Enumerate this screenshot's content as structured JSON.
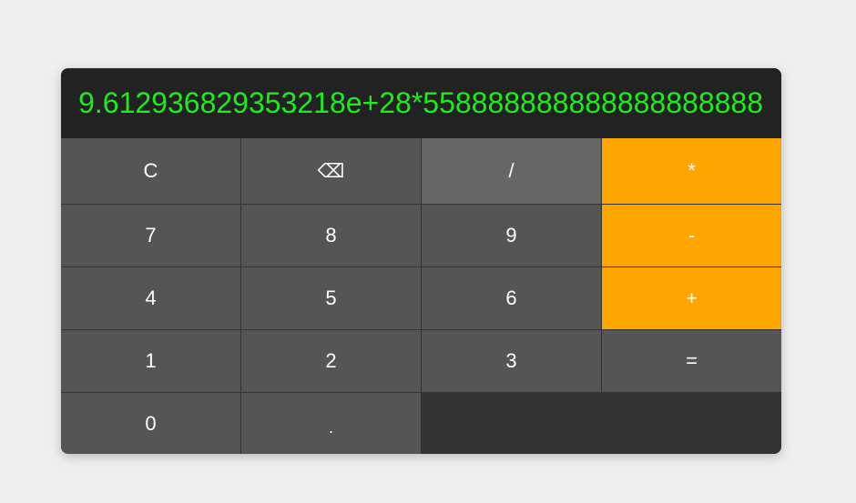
{
  "display": {
    "value": "9.612936829353218e+28*558888888888888888888"
  },
  "keys": {
    "row1": [
      "C",
      "⌫",
      "/",
      "*"
    ],
    "row2": [
      "7",
      "8",
      "9",
      "-"
    ],
    "row3": [
      "4",
      "5",
      "6",
      "+"
    ],
    "row4": [
      "1",
      "2",
      "3",
      "="
    ],
    "row5": [
      "0",
      "."
    ]
  },
  "colors": {
    "display_text": "#1cec1c",
    "operator_key": "#ffa500",
    "key": "#555555",
    "hovered_key": "#666666",
    "display_background": "#222222"
  }
}
